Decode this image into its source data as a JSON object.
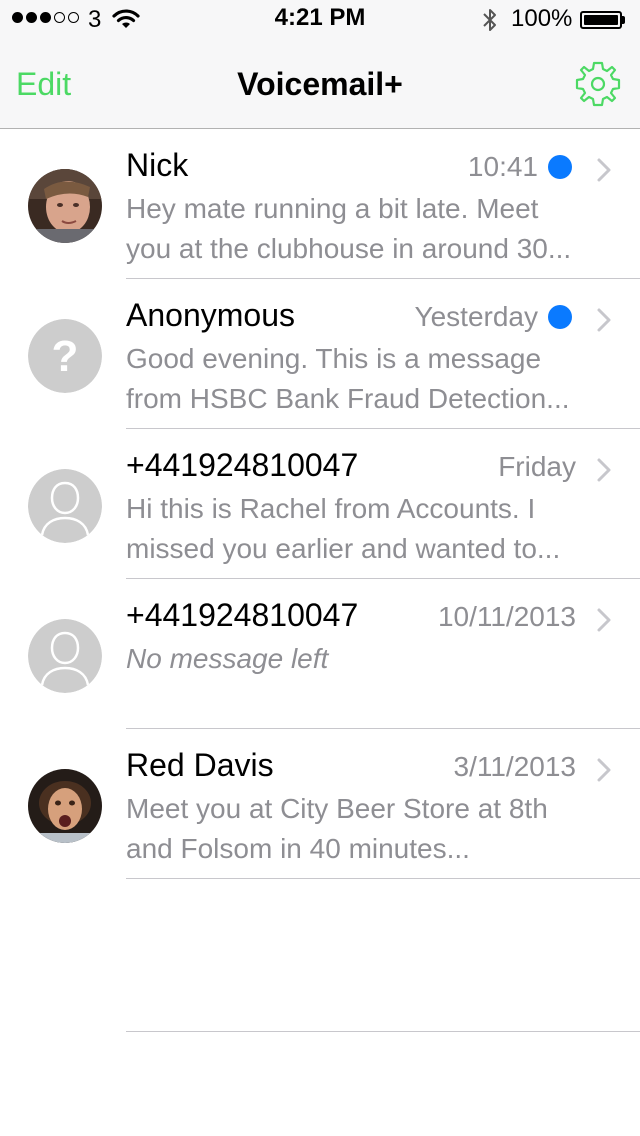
{
  "status_bar": {
    "carrier": "3",
    "time": "4:21 PM",
    "battery_percent": "100%",
    "signal_bars_filled": 3,
    "signal_bars_total": 5
  },
  "nav": {
    "edit_label": "Edit",
    "title": "Voicemail+",
    "settings_icon": "gear-icon"
  },
  "colors": {
    "accent": "#4cd964",
    "unread": "#0a7aff",
    "secondary_text": "#8e8e93"
  },
  "voicemails": [
    {
      "name": "Nick",
      "date": "10:41",
      "unread": true,
      "avatar": "photo",
      "preview_line1": "Hey mate running a bit late. Meet",
      "preview_line2": "you at the clubhouse in around 30..."
    },
    {
      "name": "Anonymous",
      "date": "Yesterday",
      "unread": true,
      "avatar": "question-mark-icon",
      "preview_line1": "Good evening. This is a message",
      "preview_line2": "from HSBC Bank Fraud Detection..."
    },
    {
      "name": "+441924810047",
      "date": "Friday",
      "unread": false,
      "avatar": "person-silhouette-icon",
      "preview_line1": "Hi this is Rachel from Accounts. I",
      "preview_line2": "missed you earlier and wanted to..."
    },
    {
      "name": "+441924810047",
      "date": "10/11/2013",
      "unread": false,
      "avatar": "person-silhouette-icon",
      "preview_line1": "No message left",
      "preview_line2": ""
    },
    {
      "name": "Red Davis",
      "date": "3/11/2013",
      "unread": false,
      "avatar": "photo",
      "preview_line1": "Meet you at City Beer Store at 8th",
      "preview_line2": "and Folsom in 40 minutes..."
    }
  ]
}
